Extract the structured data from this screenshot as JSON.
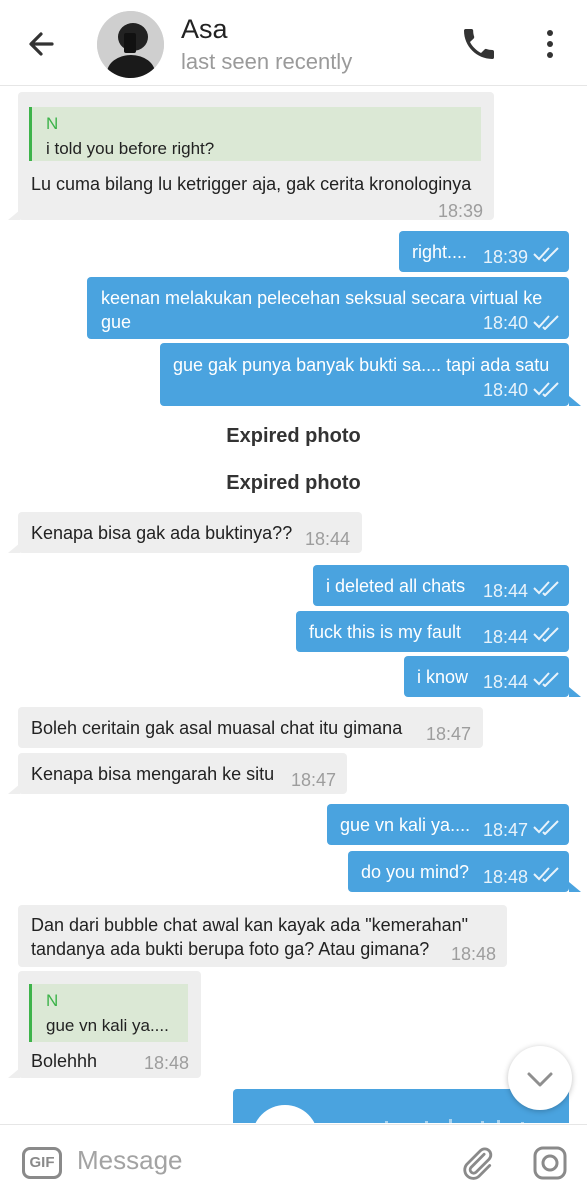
{
  "header": {
    "name": "Asa",
    "status": "last seen recently"
  },
  "messages": {
    "m1": {
      "quote_name": "N",
      "quote_text": "i told you before right?",
      "text": "Lu cuma bilang lu ketrigger aja, gak cerita kronologinya",
      "time": "18:39"
    },
    "m2": {
      "text": "right....",
      "time": "18:39"
    },
    "m3": {
      "line1": "keenan melakukan pelecehan seksual secara virtual ke",
      "line2": "gue",
      "time": "18:40"
    },
    "m4": {
      "text": "gue gak punya banyak bukti sa.... tapi ada satu",
      "time": "18:40"
    },
    "expired1": "Expired photo",
    "expired2": "Expired photo",
    "m5": {
      "text": "Kenapa bisa gak ada buktinya??",
      "time": "18:44"
    },
    "m6": {
      "text": "i deleted all chats",
      "time": "18:44"
    },
    "m7": {
      "text": "fuck this is my fault",
      "time": "18:44"
    },
    "m8": {
      "text": "i know",
      "time": "18:44"
    },
    "m9": {
      "text": "Boleh ceritain gak asal muasal chat itu gimana",
      "time": "18:47"
    },
    "m10": {
      "text": "Kenapa bisa mengarah ke situ",
      "time": "18:47"
    },
    "m11": {
      "text": "gue vn kali ya....",
      "time": "18:47"
    },
    "m12": {
      "text": "do you mind?",
      "time": "18:48"
    },
    "m13": {
      "line1": "Dan dari bubble chat awal kan kayak ada \"kemerahan\"",
      "line2": "tandanya ada bukti berupa foto ga? Atau gimana?",
      "time": "18:48"
    },
    "m14": {
      "quote_name": "N",
      "quote_text": "gue vn kali ya....",
      "text": "Bolehhh",
      "time": "18:48"
    }
  },
  "composer": {
    "gif_label": "GIF",
    "placeholder": "Message"
  },
  "colors": {
    "outgoing_bubble": "#4aa3df",
    "incoming_bubble": "#eeeeee",
    "quote_accent": "#3db34a"
  },
  "icons": [
    "back-arrow-icon",
    "phone-icon",
    "more-vert-icon",
    "double-check-icon",
    "chevron-down-icon",
    "paperclip-icon",
    "camera-icon"
  ]
}
